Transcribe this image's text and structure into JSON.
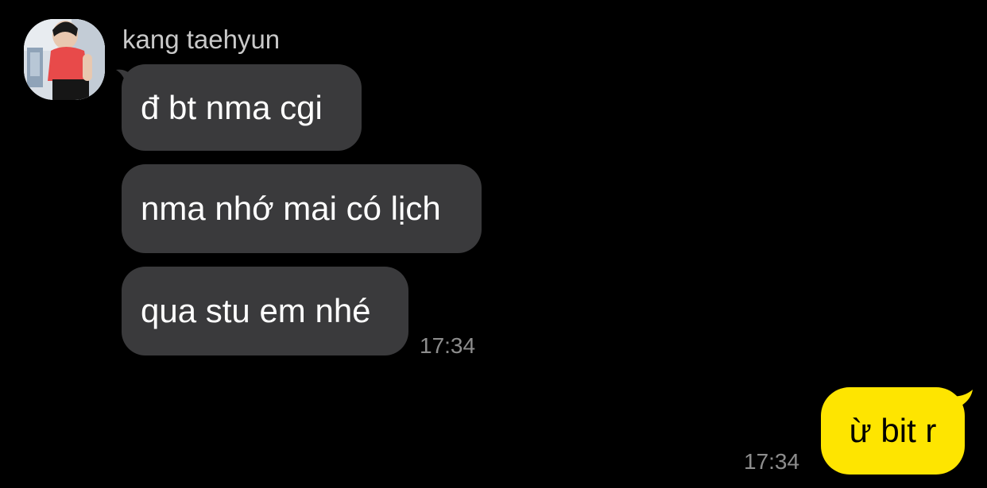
{
  "colors": {
    "background": "#000000",
    "incoming_bubble": "#3a3a3c",
    "outgoing_bubble": "#fee500",
    "timestamp": "#8d8d8d",
    "sender_name": "#c9c9c9"
  },
  "conversation": {
    "incoming": {
      "sender_name": "kang taehyun",
      "avatar_icon": "profile-photo",
      "messages": [
        {
          "text": "đ bt nma cgi"
        },
        {
          "text": "nma nhớ mai có lịch"
        },
        {
          "text": "qua stu em nhé"
        }
      ],
      "timestamp": "17:34"
    },
    "outgoing": {
      "messages": [
        {
          "text": "ừ bit r"
        }
      ],
      "timestamp": "17:34"
    }
  }
}
